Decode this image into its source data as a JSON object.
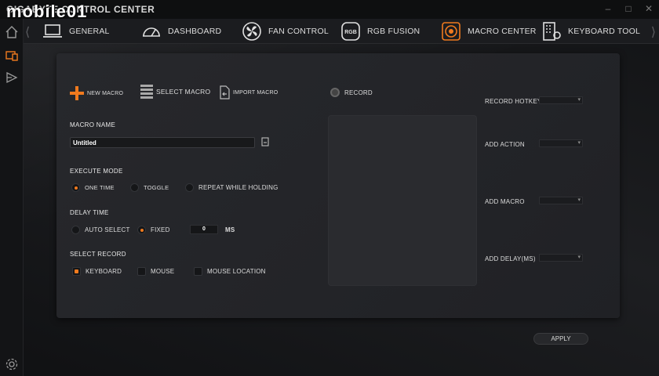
{
  "window": {
    "title": "GIGABYTE CONTROL CENTER",
    "watermark": "mobile01",
    "controls": [
      "–",
      "□",
      "✕"
    ]
  },
  "nav": {
    "left_arrow": "⟨",
    "right_arrow": "⟩",
    "tabs": [
      {
        "label": "GENERAL",
        "icon": "laptop-icon"
      },
      {
        "label": "DASHBOARD",
        "icon": "gauge-icon"
      },
      {
        "label": "FAN CONTROL",
        "icon": "fan-icon"
      },
      {
        "label": "RGB FUSION",
        "icon": "rgb-icon"
      },
      {
        "label": "MACRO CENTER",
        "icon": "macro-icon",
        "active": true
      },
      {
        "label": "KEYBOARD TOOL",
        "icon": "keyboard-icon"
      }
    ]
  },
  "rgb_badge": "RGB",
  "actions": {
    "new_macro": "NEW MACRO",
    "select_macro": "SELECT MACRO",
    "import_macro": "IMPORT MACRO",
    "record": "RECORD"
  },
  "macro_name": {
    "label": "MACRO NAME",
    "value": "Untitled"
  },
  "execute_mode": {
    "label": "EXECUTE MODE",
    "options": [
      "ONE TIME",
      "TOGGLE",
      "REPEAT WHILE HOLDING"
    ],
    "selected": "ONE TIME"
  },
  "delay_time": {
    "label": "DELAY TIME",
    "options": [
      "AUTO SELECT",
      "FIXED"
    ],
    "selected": "FIXED",
    "value": "0",
    "unit": "MS"
  },
  "select_record": {
    "label": "SELECT RECORD",
    "options": [
      "KEYBOARD",
      "MOUSE",
      "MOUSE LOCATION"
    ],
    "selected": "KEYBOARD"
  },
  "right_panel": {
    "record_hotkey": "RECORD HOTKEY",
    "add_action": "ADD ACTION",
    "add_macro": "ADD MACRO",
    "add_delay": "ADD DELAY(MS)"
  },
  "apply": "APPLY",
  "colors": {
    "accent": "#f07a1e"
  }
}
